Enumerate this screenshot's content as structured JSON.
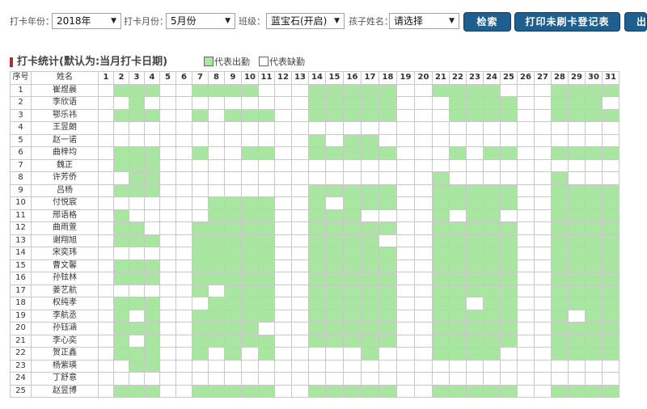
{
  "filters": {
    "year_label": "打卡年份：",
    "year_value": "2018年",
    "month_label": "打卡月份：",
    "month_value": "5月份",
    "class_label": "班级：",
    "class_value": "蓝宝石(开启)",
    "child_label": "孩子姓名：",
    "child_value": "请选择",
    "search_button": "检索",
    "print_button": "打印未刷卡登记表",
    "export_button": "出"
  },
  "section": {
    "title": "打卡统计(默认为:当月打卡日期)",
    "legend_present": "代表出勤",
    "legend_absent": "代表缺勤"
  },
  "colors": {
    "present": "#a8e6a1",
    "absent": "#ffffff",
    "button": "#1f5f8f",
    "title_marker": "#a83232"
  },
  "table": {
    "col_index": "序号",
    "col_name": "姓名",
    "days": [
      "1",
      "2",
      "3",
      "4",
      "5",
      "6",
      "7",
      "8",
      "9",
      "10",
      "11",
      "12",
      "13",
      "14",
      "15",
      "16",
      "17",
      "18",
      "19",
      "20",
      "21",
      "22",
      "23",
      "24",
      "25",
      "26",
      "27",
      "28",
      "29",
      "30",
      "31"
    ],
    "rows": [
      {
        "index": "1",
        "name": "崔煜晨",
        "att": "0111001111000111110011110001111"
      },
      {
        "index": "2",
        "name": "李欣语",
        "att": "0010000000000111110001111001110"
      },
      {
        "index": "3",
        "name": "鄂乐祎",
        "att": "0111001011100111110001111001111"
      },
      {
        "index": "4",
        "name": "王昱朗",
        "att": "0000000000000000000000000000000"
      },
      {
        "index": "5",
        "name": "赵一诺",
        "att": "0000000000000101100000000000000"
      },
      {
        "index": "6",
        "name": "曲梓均",
        "att": "0111001001100111110001011001111"
      },
      {
        "index": "7",
        "name": "魏正",
        "att": "0111000000000000000000000000000"
      },
      {
        "index": "8",
        "name": "许芳侨",
        "att": "0011000000000000000010000001000"
      },
      {
        "index": "9",
        "name": "吕杨",
        "att": "0111000000000111110011111001111"
      },
      {
        "index": "10",
        "name": "付悦宸",
        "att": "0000000111100101110011111001111"
      },
      {
        "index": "11",
        "name": "邢语格",
        "att": "0100000111100111000010110001111"
      },
      {
        "index": "12",
        "name": "曲雨萱",
        "att": "0110001111100111110011111001111"
      },
      {
        "index": "13",
        "name": "谢翔旭",
        "att": "0111001111100111100011111001111"
      },
      {
        "index": "14",
        "name": "宋奕玮",
        "att": "0000001111100111110011111001111"
      },
      {
        "index": "15",
        "name": "曹文馨",
        "att": "0111001111100111110011111001111"
      },
      {
        "index": "16",
        "name": "孙铉林",
        "att": "0111001111100111110011111001111"
      },
      {
        "index": "17",
        "name": "姜艺航",
        "att": "0000001011100111110011111001111"
      },
      {
        "index": "18",
        "name": "权纯孝",
        "att": "0111000111100111110011011001111"
      },
      {
        "index": "19",
        "name": "李航丞",
        "att": "0101001111100111110011111001011"
      },
      {
        "index": "20",
        "name": "孙钰涵",
        "att": "0111001111000111110011111001111"
      },
      {
        "index": "21",
        "name": "李心奕",
        "att": "0101001111100111110011111001111"
      },
      {
        "index": "22",
        "name": "贺正鑫",
        "att": "0111001010100000100011110001111"
      },
      {
        "index": "23",
        "name": "杨紫瑛",
        "att": "0011000000000000000000000000000"
      },
      {
        "index": "24",
        "name": "丁舒意",
        "att": "0000000000000000000000000000000"
      },
      {
        "index": "25",
        "name": "赵昱博",
        "att": "0111001111100111110011111001111"
      }
    ]
  }
}
